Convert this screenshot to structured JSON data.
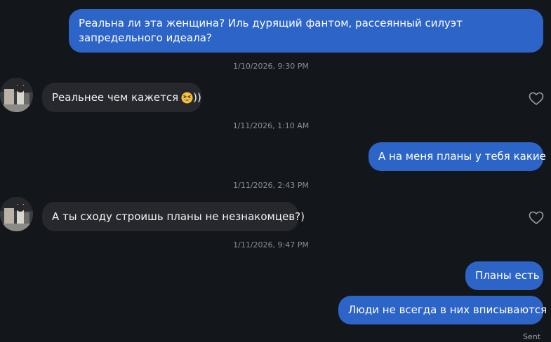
{
  "messages": {
    "m1": "Реальна ли эта женщина? Иль дурящий фантом, рассеянный силуэт запредельного идеала?",
    "t1": "1/10/2026, 9:30 PM",
    "m2": "Реальнее чем кажется",
    "m2_suffix": "))",
    "t2": "1/11/2026, 1:10 AM",
    "m3": "А на меня планы у тебя какие",
    "t3": "1/11/2026, 2:43 PM",
    "m4": "А ты сходу строишь планы не незнакомцев?)",
    "t4": "1/11/2026, 9:47 PM",
    "m5": "Планы есть",
    "m6": "Люди не всегда в них вписываются"
  },
  "status": {
    "sent": "Sent"
  },
  "icons": {
    "like": "heart-outline-icon",
    "emoji": "grinning-squinting-face-emoji",
    "avatar": "contact-avatar"
  },
  "colors": {
    "background": "#13161b",
    "outgoing_bubble": "#2d64c8",
    "incoming_bubble": "#26282e",
    "timestamp": "#8a8e96"
  }
}
